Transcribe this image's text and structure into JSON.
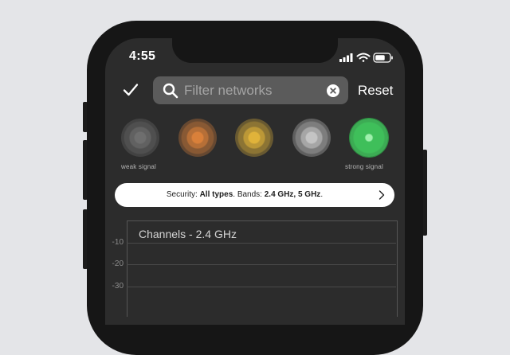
{
  "status_bar": {
    "time": "4:55"
  },
  "toolbar": {
    "confirm_icon": "checkmark-icon",
    "search": {
      "placeholder": "Filter networks",
      "search_icon": "magnifier-icon",
      "clear_icon": "clear-x-icon"
    },
    "reset_label": "Reset"
  },
  "signal_filter": {
    "levels": [
      {
        "name": "level-1",
        "color": "#6e6e6e"
      },
      {
        "name": "level-2",
        "color": "#d9803a"
      },
      {
        "name": "level-3",
        "color": "#e0b33a"
      },
      {
        "name": "level-4",
        "color": "#c4c4c4"
      },
      {
        "name": "level-5",
        "color": "#3fbf5a",
        "selected": true
      }
    ],
    "weak_label": "weak signal",
    "strong_label": "strong signal"
  },
  "filter_summary": {
    "security_prefix": "Security: ",
    "security_value": "All types",
    "bands_prefix": ". Bands: ",
    "bands_value": "2.4 GHz, 5 GHz",
    "suffix": "."
  },
  "chart_data": {
    "type": "bar",
    "title": "Channels - 2.4 GHz",
    "y_ticks": [
      "-10",
      "-20",
      "-30"
    ]
  }
}
